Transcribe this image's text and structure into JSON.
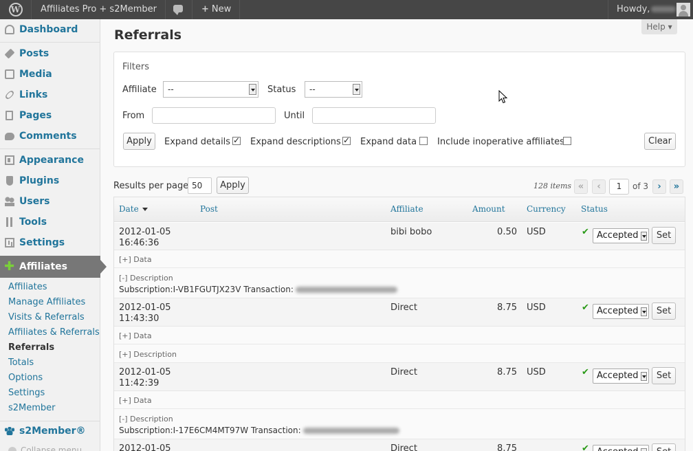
{
  "adminbar": {
    "site_name": "Affiliates Pro + s2Member",
    "new_label": "New",
    "howdy": "Howdy,"
  },
  "sidebar": {
    "menu": [
      {
        "label": "Dashboard",
        "icon": "dashboard-icon"
      },
      {
        "label": "Posts",
        "icon": "pin-icon"
      },
      {
        "label": "Media",
        "icon": "media-icon"
      },
      {
        "label": "Links",
        "icon": "link-icon"
      },
      {
        "label": "Pages",
        "icon": "page-icon"
      },
      {
        "label": "Comments",
        "icon": "comment-icon"
      },
      {
        "label": "Appearance",
        "icon": "appearance-icon"
      },
      {
        "label": "Plugins",
        "icon": "plugin-icon"
      },
      {
        "label": "Users",
        "icon": "users-icon"
      },
      {
        "label": "Tools",
        "icon": "tools-icon"
      },
      {
        "label": "Settings",
        "icon": "settings-icon"
      }
    ],
    "affiliates_head": "Affiliates",
    "submenu": [
      "Affiliates",
      "Manage Affiliates",
      "Visits & Referrals",
      "Affiliates & Referrals",
      "Referrals",
      "Totals",
      "Options",
      "Settings",
      "s2Member"
    ],
    "current_sub": "Referrals",
    "s2member": "s2Member®",
    "collapse": "Collapse menu"
  },
  "page": {
    "title": "Referrals",
    "help": "Help ▾"
  },
  "filters": {
    "title": "Filters",
    "affiliate_label": "Affiliate",
    "affiliate_value": "--",
    "status_label": "Status",
    "status_value": "--",
    "from_label": "From",
    "until_label": "Until",
    "apply": "Apply",
    "expand_details": "Expand details",
    "expand_descriptions": "Expand descriptions",
    "expand_data": "Expand data",
    "include_inoperative": "Include inoperative affiliates",
    "clear": "Clear"
  },
  "results": {
    "per_page_label": "Results per page",
    "per_page_value": "50",
    "apply": "Apply",
    "count": "128 items",
    "first": "«",
    "prev": "‹",
    "current_page": "1",
    "of_pages": "of 3",
    "next": "›",
    "last": "»"
  },
  "table": {
    "columns": [
      "Date",
      "Post",
      "Affiliate",
      "Amount",
      "Currency",
      "Status"
    ],
    "data_toggle_collapsed": "[+] Data",
    "desc_toggle_expanded": "[-] Description",
    "desc_toggle_collapsed": "[+] Description",
    "status_option": "Accepted",
    "set_label": "Set",
    "rows": [
      {
        "date": "2012-01-05",
        "time": "16:46:36",
        "affiliate": "bibi bobo",
        "amount": "0.50",
        "currency": "USD",
        "desc": "Subscription:I-VB1FGUTJX23V Transaction:"
      },
      {
        "date": "2012-01-05",
        "time": "11:43:30",
        "affiliate": "Direct",
        "amount": "8.75",
        "currency": "USD"
      },
      {
        "date": "2012-01-05",
        "time": "11:42:39",
        "affiliate": "Direct",
        "amount": "8.75",
        "currency": "USD",
        "desc": "Subscription:I-17E6CM4MT97W Transaction:"
      },
      {
        "date": "2012-01-05",
        "affiliate": "Direct",
        "amount": "8.75"
      }
    ]
  },
  "colors": {
    "link": "#21759b",
    "adminbar": "#464646",
    "accepted_check": "#2a9a18"
  }
}
